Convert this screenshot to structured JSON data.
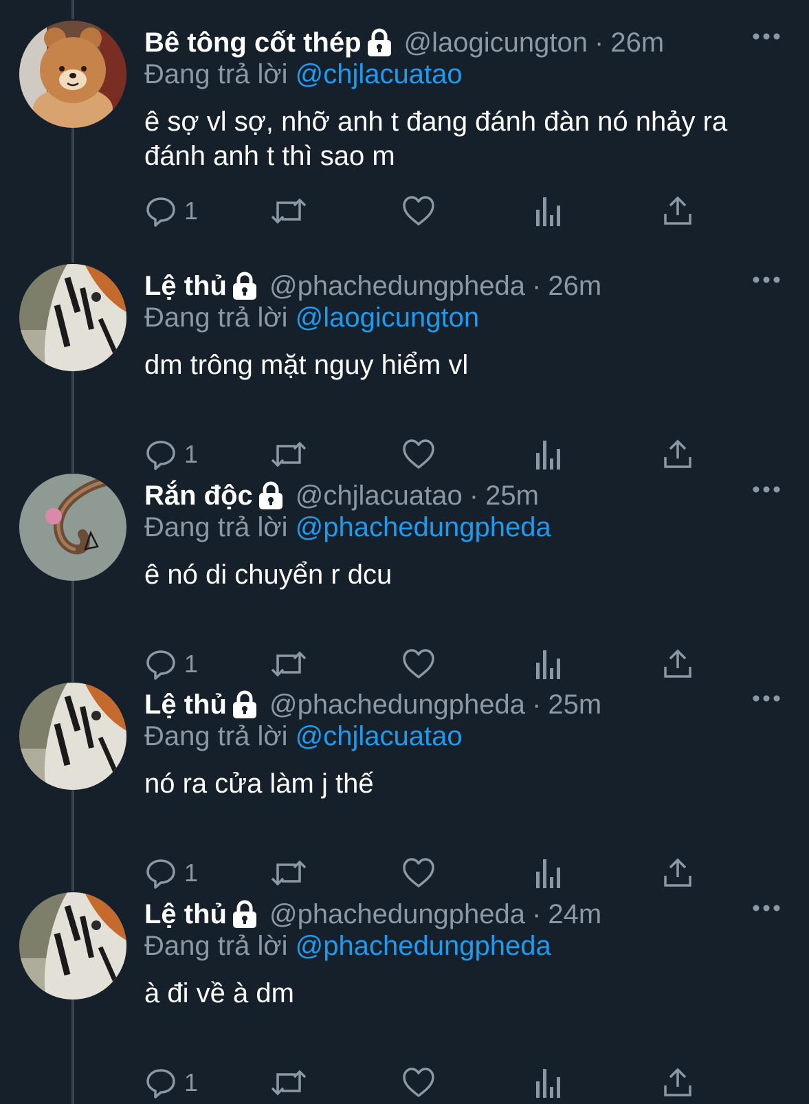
{
  "tweets": [
    {
      "name": "Bê tông cốt thép",
      "handle": "@laogicungton",
      "time": "26m",
      "reply_prefix": "Đang trả lời",
      "reply_to": "@chjlacuatao",
      "text": "ê sợ vl sợ, nhỡ anh t đang đánh đàn nó nhảy ra đánh anh t thì sao m",
      "reply_count": "1",
      "avatar": "bear"
    },
    {
      "name": "Lệ thủ",
      "handle": "@phachedungpheda",
      "time": "26m",
      "reply_prefix": "Đang trả lời",
      "reply_to": "@laogicungton",
      "text": "dm trông mặt nguy hiểm vl",
      "reply_count": "1",
      "avatar": "tiger"
    },
    {
      "name": "Rắn độc",
      "handle": "@chjlacuatao",
      "time": "25m",
      "reply_prefix": "Đang trả lời",
      "reply_to": "@phachedungpheda",
      "text": "ê nó di chuyển r dcu",
      "reply_count": "1",
      "avatar": "snake"
    },
    {
      "name": "Lệ thủ",
      "handle": "@phachedungpheda",
      "time": "25m",
      "reply_prefix": "Đang trả lời",
      "reply_to": "@chjlacuatao",
      "text": "nó ra cửa làm j thế",
      "reply_count": "1",
      "avatar": "tiger"
    },
    {
      "name": "Lệ thủ",
      "handle": "@phachedungpheda",
      "time": "24m",
      "reply_prefix": "Đang trả lời",
      "reply_to": "@phachedungpheda",
      "text": "à đi về à dm",
      "reply_count": "1",
      "avatar": "tiger"
    }
  ],
  "separator": "·",
  "colors": {
    "background": "#15202b",
    "secondary_text": "#8b98a5",
    "mention": "#1d9bf0",
    "thread_line": "#38444d"
  },
  "icons": [
    "lock-icon",
    "more-icon",
    "reply-icon",
    "retweet-icon",
    "like-icon",
    "views-icon",
    "share-icon"
  ]
}
